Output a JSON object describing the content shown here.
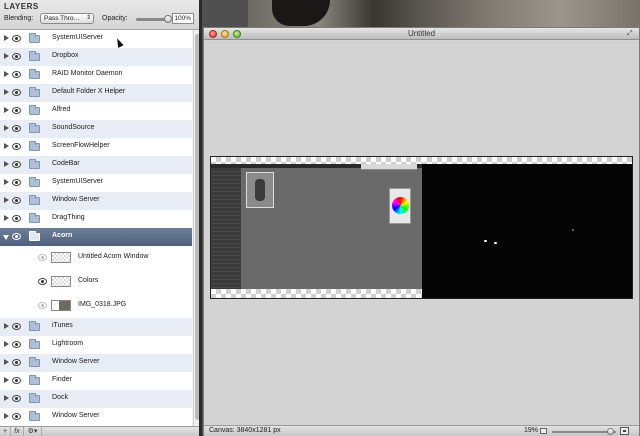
{
  "panel": {
    "title": "LAYERS",
    "blending_label": "Blending:",
    "blending_value": "Pass Thro…",
    "opacity_label": "Opacity:",
    "opacity_value": "100%",
    "opacity_fraction": 1.0
  },
  "layers": [
    {
      "name": "SystemUIServer",
      "type": "folder"
    },
    {
      "name": "Dropbox",
      "type": "folder"
    },
    {
      "name": "RAID Monitor Daemon",
      "type": "folder"
    },
    {
      "name": "Default Folder X Helper",
      "type": "folder"
    },
    {
      "name": "Alfred",
      "type": "folder"
    },
    {
      "name": "SoundSource",
      "type": "folder"
    },
    {
      "name": "ScreenFlowHelper",
      "type": "folder"
    },
    {
      "name": "CodeBar",
      "type": "folder"
    },
    {
      "name": "SystemUIServer",
      "type": "folder"
    },
    {
      "name": "Window Server",
      "type": "folder"
    },
    {
      "name": "DragThing",
      "type": "folder"
    },
    {
      "name": "Acorn",
      "type": "folder",
      "expanded": true,
      "selected": true
    },
    {
      "name": "Untitled Acorn Window",
      "type": "layer",
      "child": true,
      "visible": false
    },
    {
      "name": "Colors",
      "type": "layer",
      "child": true,
      "visible": true
    },
    {
      "name": "IMG_0318.JPG",
      "type": "image",
      "child": true,
      "visible": false
    },
    {
      "name": "iTunes",
      "type": "folder"
    },
    {
      "name": "Lightroom",
      "type": "folder"
    },
    {
      "name": "Window Server",
      "type": "folder"
    },
    {
      "name": "Finder",
      "type": "folder"
    },
    {
      "name": "Dock",
      "type": "folder"
    },
    {
      "name": "Window Server",
      "type": "folder"
    }
  ],
  "footer": {
    "add": "+",
    "fx": "fx",
    "gear": "⚙▾"
  },
  "window": {
    "title": "Untitled",
    "canvas_size": "Canvas: 3840x1281 px",
    "zoom": "19%",
    "zoom_fraction": 0.92
  },
  "colors": {
    "selection": "#55667f",
    "alt_row": "#e8edf5"
  }
}
